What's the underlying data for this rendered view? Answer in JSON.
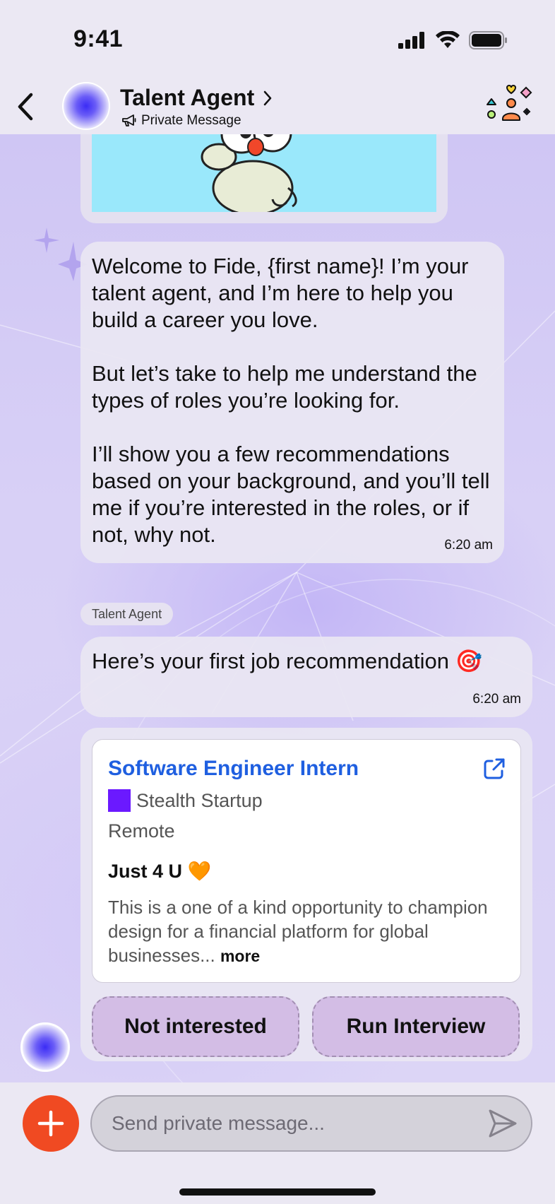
{
  "status_bar": {
    "time": "9:41",
    "icons": [
      "cellular-signal-icon",
      "wifi-icon",
      "battery-icon"
    ]
  },
  "header": {
    "title": "Talent Agent",
    "subtitle": "Private Message",
    "icons": [
      "back-chevron-icon",
      "chevron-right-icon",
      "megaphone-icon",
      "group-people-icon"
    ]
  },
  "messages": {
    "welcome": {
      "text": "Welcome to Fide, {first name}! I’m your talent agent, and I’m here to help you build a career you love.\n\nBut let’s take to help me understand the types of roles you’re looking for.\n\nI’ll show you a few recommendations based on your background, and you’ll tell me if you’re interested in the roles, or if not, why not.",
      "time": "6:20 am"
    },
    "sender_tag": "Talent Agent",
    "recommendation": {
      "text": "Here’s your first job recommendation 🎯",
      "time": "6:20 am"
    }
  },
  "job_card": {
    "title": "Software Engineer Intern",
    "company": "Stealth Startup",
    "company_logo_color": "#6b19ff",
    "location": "Remote",
    "tag": "Just 4 U 🧡",
    "description": "This is a one of a kind opportunity to champion design for a financial platform for global businesses...",
    "more_label": "more",
    "actions": {
      "not_interested": "Not interested",
      "run_interview": "Run Interview"
    }
  },
  "composer": {
    "placeholder": "Send private message...",
    "accent_color": "#f04a22"
  },
  "colors": {
    "link_blue": "#1f5fe0",
    "button_fill": "#d3bde5",
    "chat_background": "#d8d0f6"
  }
}
